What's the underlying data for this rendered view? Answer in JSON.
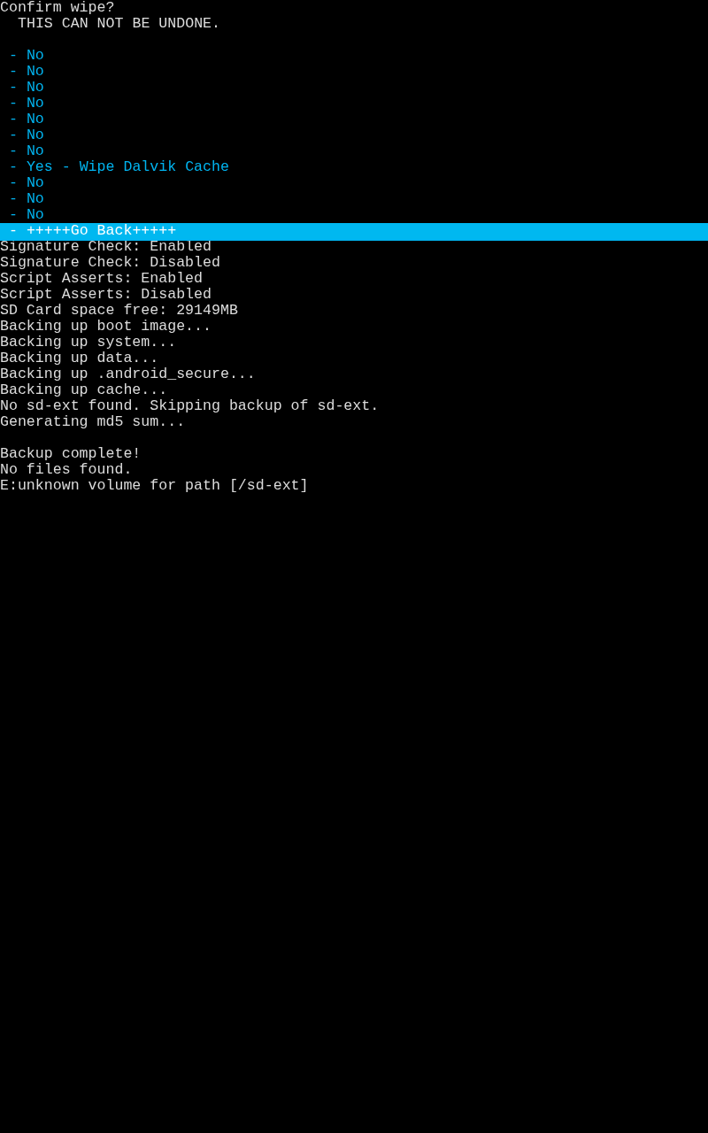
{
  "header": [
    "Confirm wipe?",
    "THIS CAN NOT BE UNDONE."
  ],
  "menu": [
    {
      "label": "- No",
      "selected": false
    },
    {
      "label": "- No",
      "selected": false
    },
    {
      "label": "- No",
      "selected": false
    },
    {
      "label": "- No",
      "selected": false
    },
    {
      "label": "- No",
      "selected": false
    },
    {
      "label": "- No",
      "selected": false
    },
    {
      "label": "- No",
      "selected": false
    },
    {
      "label": "- Yes - Wipe Dalvik Cache",
      "selected": false
    },
    {
      "label": "- No",
      "selected": false
    },
    {
      "label": "- No",
      "selected": false
    },
    {
      "label": "- No",
      "selected": false
    },
    {
      "label": "- +++++Go Back+++++",
      "selected": true
    }
  ],
  "log_blocks": [
    {
      "lines": [
        "Signature Check: Enabled",
        "Signature Check: Disabled",
        "Script Asserts: Enabled",
        "Script Asserts: Disabled",
        "SD Card space free: 29149MB",
        "Backing up boot image...",
        "Backing up system...",
        "Backing up data...",
        "Backing up .android_secure...",
        "Backing up cache...",
        "No sd-ext found. Skipping backup of sd-ext.",
        "Generating md5 sum..."
      ]
    },
    {
      "lines": [
        "Backup complete!",
        "No files found.",
        "E:unknown volume for path [/sd-ext]"
      ]
    }
  ]
}
